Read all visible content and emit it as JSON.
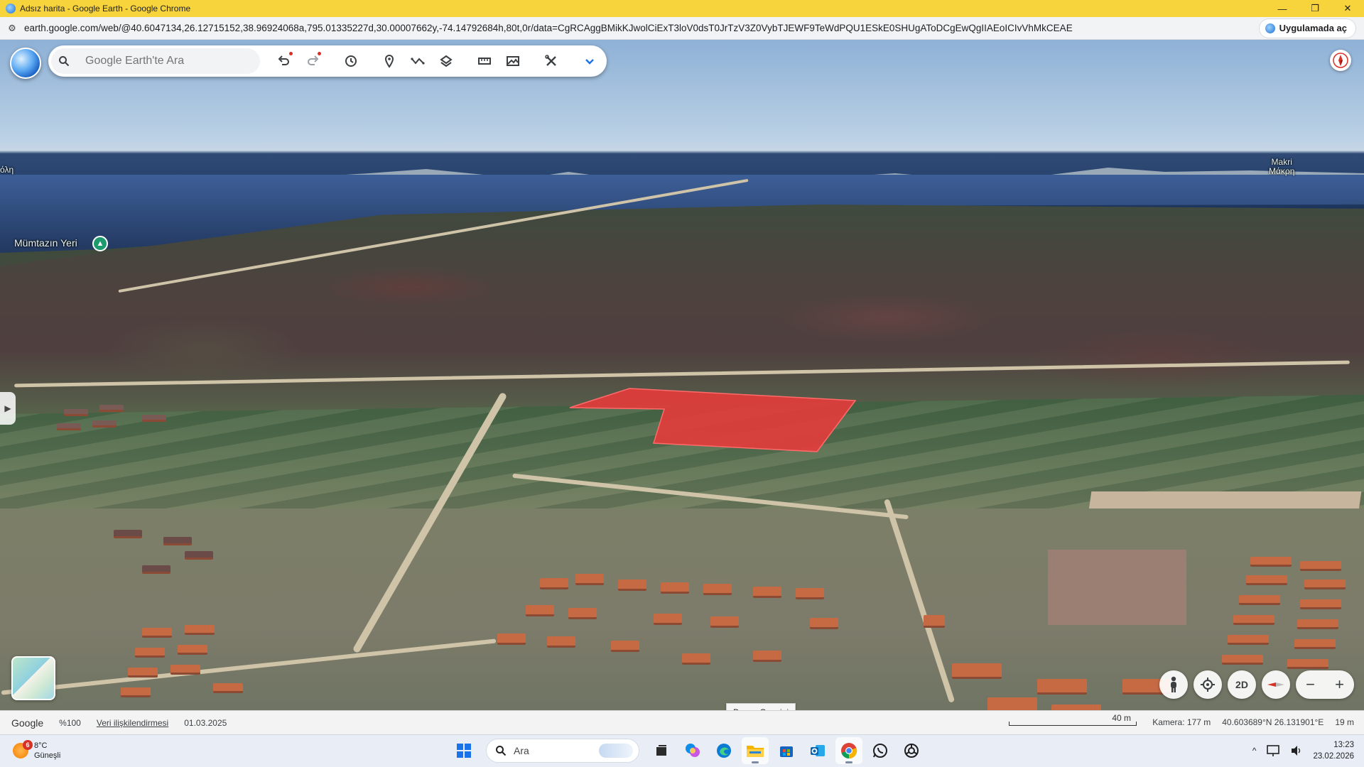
{
  "window": {
    "title": "Adsız harita - Google Earth - Google Chrome",
    "minimize": "—",
    "maximize": "❐",
    "close": "✕"
  },
  "address": {
    "url": "earth.google.com/web/@40.6047134,26.12715152,38.96924068a,795.01335227d,30.00007662y,-74.14792684h,80t,0r/data=CgRCAggBMikKJwolCiExT3loV0dsT0JrTzV3Z0VybTJEWF9TeWdPQU1ESkE0SHUgAToDCgEwQgIIAEoICIvVhMkCEAE",
    "open_app": "Uygulamada aç"
  },
  "toolbar": {
    "search_placeholder": "Google Earth'te Ara"
  },
  "map": {
    "place_labels": [
      {
        "text": "Mümtazın Yeri"
      },
      {
        "text": "Makri\nΜάκρη"
      },
      {
        "text": "όλη"
      }
    ],
    "parcel_color": "#e83a3a"
  },
  "controls": {
    "mode_2d": "2D",
    "zoom_out": "−",
    "zoom_in": "+"
  },
  "tooltip": "Dosya Gezgini",
  "status": {
    "brand": "Google",
    "zoom": "%100",
    "data_attribution": "Veri ilişkilendirmesi",
    "date": "01.03.2025",
    "scale": "40 m",
    "camera": "Kamera: 177 m",
    "coords": "40.603689°N 26.131901°E",
    "elevation": "19 m"
  },
  "taskbar": {
    "weather_temp": "8°C",
    "weather_desc": "Güneşli",
    "weather_badge": "6",
    "search_label": "Ara",
    "time": "13:23",
    "date": "23.02.2026"
  },
  "colors": {
    "title_bar": "#f7d33c",
    "parcel": "#e83a3a",
    "house_roof": "#c66a44"
  }
}
